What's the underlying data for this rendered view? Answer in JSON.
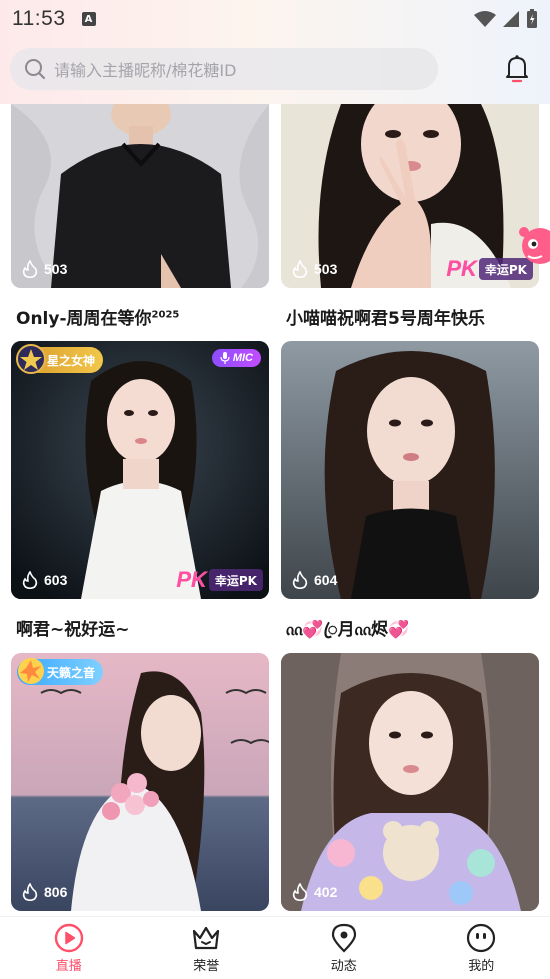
{
  "status_bar": {
    "time": "11:53",
    "notification_badge": "A"
  },
  "search": {
    "placeholder": "请输入主播昵称/棉花糖ID"
  },
  "colors": {
    "accent": "#ff4f6a",
    "nav_text": "#222222"
  },
  "cards": [
    {
      "title": "Only-周周在等你",
      "title_sup": "2025",
      "viewers": "503"
    },
    {
      "title": "小喵喵祝啊君5号周年快乐",
      "viewers": "503",
      "pk_label": "幸运PK"
    },
    {
      "title": "啊君~祝好运~",
      "viewers": "603",
      "badge": "星之女神",
      "mic_label": "MIC",
      "pk_label": "幸运PK"
    },
    {
      "title": "ᦶ💞ꦿ月ᦶ烬💞",
      "viewers": "604"
    },
    {
      "title": "",
      "viewers": "806",
      "badge": "天籁之音"
    },
    {
      "title": "",
      "viewers": "402"
    }
  ],
  "pk": {
    "logo": "PK"
  },
  "nav": [
    {
      "label": "直播",
      "icon": "live-play-icon",
      "active": true
    },
    {
      "label": "荣誉",
      "icon": "crown-icon",
      "active": false
    },
    {
      "label": "动态",
      "icon": "location-pin-icon",
      "active": false
    },
    {
      "label": "我的",
      "icon": "profile-face-icon",
      "active": false
    }
  ]
}
